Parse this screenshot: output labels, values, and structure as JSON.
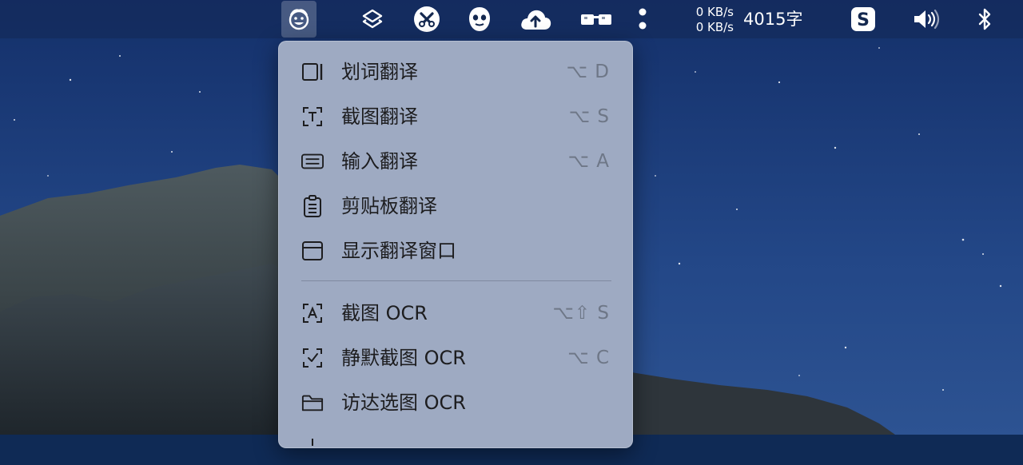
{
  "menubar": {
    "icons": [
      "translator-app-icon",
      "layers-icon",
      "scissors-icon",
      "ghost-face-icon",
      "cloud-upload-icon",
      "glasses-icon",
      "more-vertical-icon"
    ],
    "net_up": "0 KB/s",
    "net_down": "0 KB/s",
    "word_count": "4015字",
    "sogou_icon": "sogou-s-icon",
    "volume_icon": "volume-icon",
    "bluetooth_icon": "bluetooth-icon"
  },
  "menu": {
    "items": [
      {
        "label": "划词翻译",
        "shortcut": "⌥ D",
        "icon": "sidebar-panel-icon"
      },
      {
        "label": "截图翻译",
        "shortcut": "⌥ S",
        "icon": "text-scan-icon"
      },
      {
        "label": "输入翻译",
        "shortcut": "⌥ A",
        "icon": "keyboard-input-icon"
      },
      {
        "label": "剪贴板翻译",
        "shortcut": "",
        "icon": "clipboard-icon"
      },
      {
        "label": "显示翻译窗口",
        "shortcut": "",
        "icon": "window-icon"
      },
      {
        "label": "截图 OCR",
        "shortcut": "⌥⇧ S",
        "icon": "ocr-scan-icon"
      },
      {
        "label": "静默截图 OCR",
        "shortcut": "⌥ C",
        "icon": "silent-ocr-icon"
      },
      {
        "label": "访达选图 OCR",
        "shortcut": "",
        "icon": "folder-icon"
      }
    ]
  },
  "colors": {
    "menubar_bg": "#14284f",
    "menu_bg": "#9eaac2",
    "menu_text": "#1d1d1f",
    "shortcut_text": "#6e7787"
  }
}
